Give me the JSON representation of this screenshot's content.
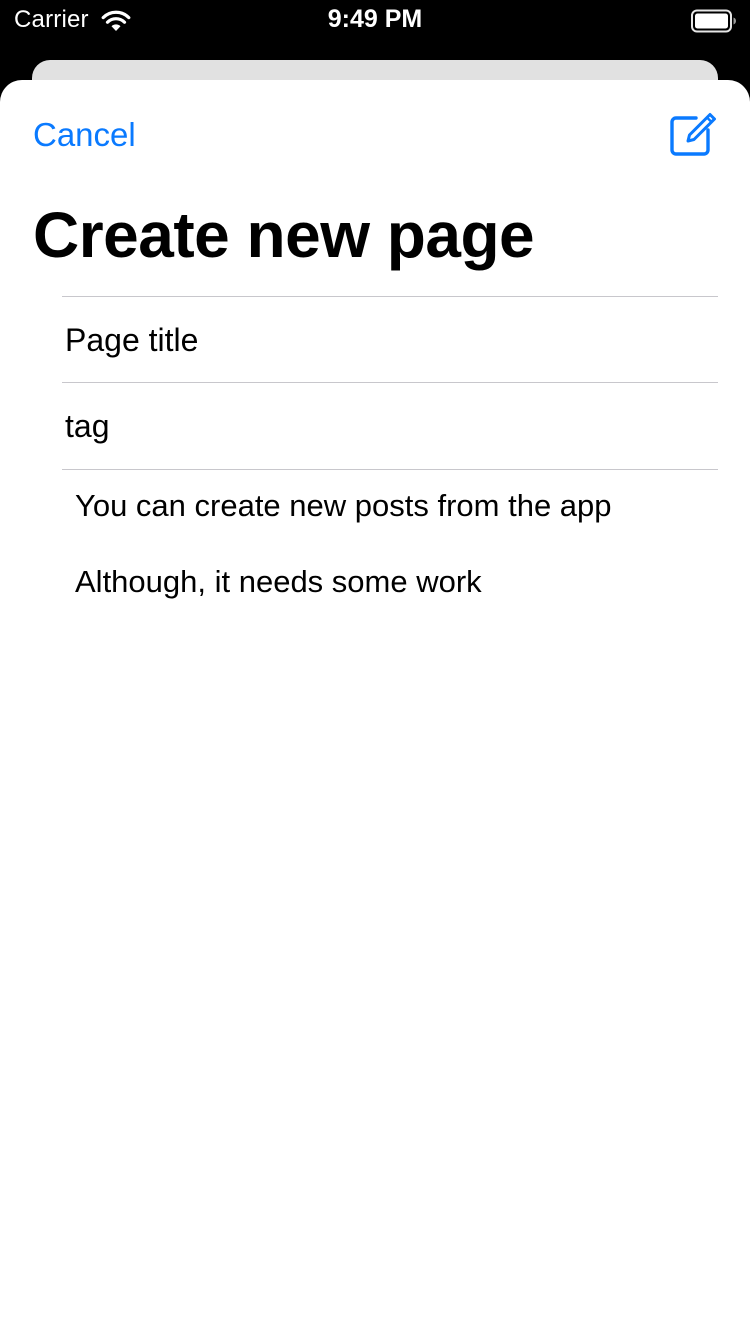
{
  "status_bar": {
    "carrier": "Carrier",
    "time": "9:49 PM"
  },
  "nav": {
    "cancel_label": "Cancel",
    "compose_icon": "square-and-pencil-icon",
    "accent_color": "#0a7aff"
  },
  "page": {
    "title": "Create new page"
  },
  "form": {
    "title_placeholder": "Page title",
    "tag_placeholder": "tag",
    "body_lines": [
      "You can create new posts from the app",
      "Although, it needs some work"
    ]
  }
}
